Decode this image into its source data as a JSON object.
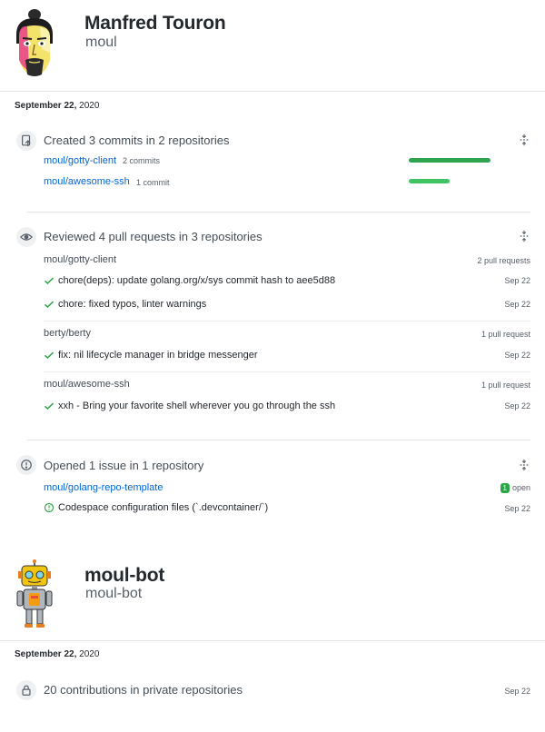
{
  "user1": {
    "name": "Manfred Touron",
    "login": "moul"
  },
  "date1": {
    "label": "September 22,",
    "year": "2020"
  },
  "commits": {
    "title": "Created 3 commits in 2 repositories",
    "repos": [
      {
        "name": "moul/gotty-client",
        "count": "2 commits",
        "share": 1.0
      },
      {
        "name": "moul/awesome-ssh",
        "count": "1 commit",
        "share": 0.5
      }
    ],
    "bar_colors": [
      "#2ea44f",
      "#40c463"
    ]
  },
  "reviews": {
    "title": "Reviewed 4 pull requests in 3 repositories",
    "groups": [
      {
        "repo": "moul/gotty-client",
        "count": "2 pull requests",
        "items": [
          {
            "title": "chore(deps): update golang.org/x/sys commit hash to aee5d88",
            "date": "Sep 22"
          },
          {
            "title": "chore: fixed typos, linter warnings",
            "date": "Sep 22"
          }
        ]
      },
      {
        "repo": "berty/berty",
        "count": "1 pull request",
        "items": [
          {
            "title": "fix: nil lifecycle manager in bridge messenger",
            "date": "Sep 22"
          }
        ]
      },
      {
        "repo": "moul/awesome-ssh",
        "count": "1 pull request",
        "items": [
          {
            "title": "xxh - Bring your favorite shell wherever you go through the ssh",
            "date": "Sep 22"
          }
        ]
      }
    ]
  },
  "issues": {
    "title": "Opened 1 issue in 1 repository",
    "repo": "moul/golang-repo-template",
    "open_count": "1",
    "open_label": "open",
    "items": [
      {
        "title": "Codespace configuration files (`.devcontainer/`)",
        "date": "Sep 22"
      }
    ]
  },
  "user2": {
    "name": "moul-bot",
    "login": "moul-bot"
  },
  "date2": {
    "label": "September 22,",
    "year": "2020"
  },
  "private": {
    "title": "20 contributions in private repositories",
    "date": "Sep 22"
  },
  "colors": {
    "link": "#0366d6",
    "success": "#28a745",
    "muted": "#586069"
  }
}
